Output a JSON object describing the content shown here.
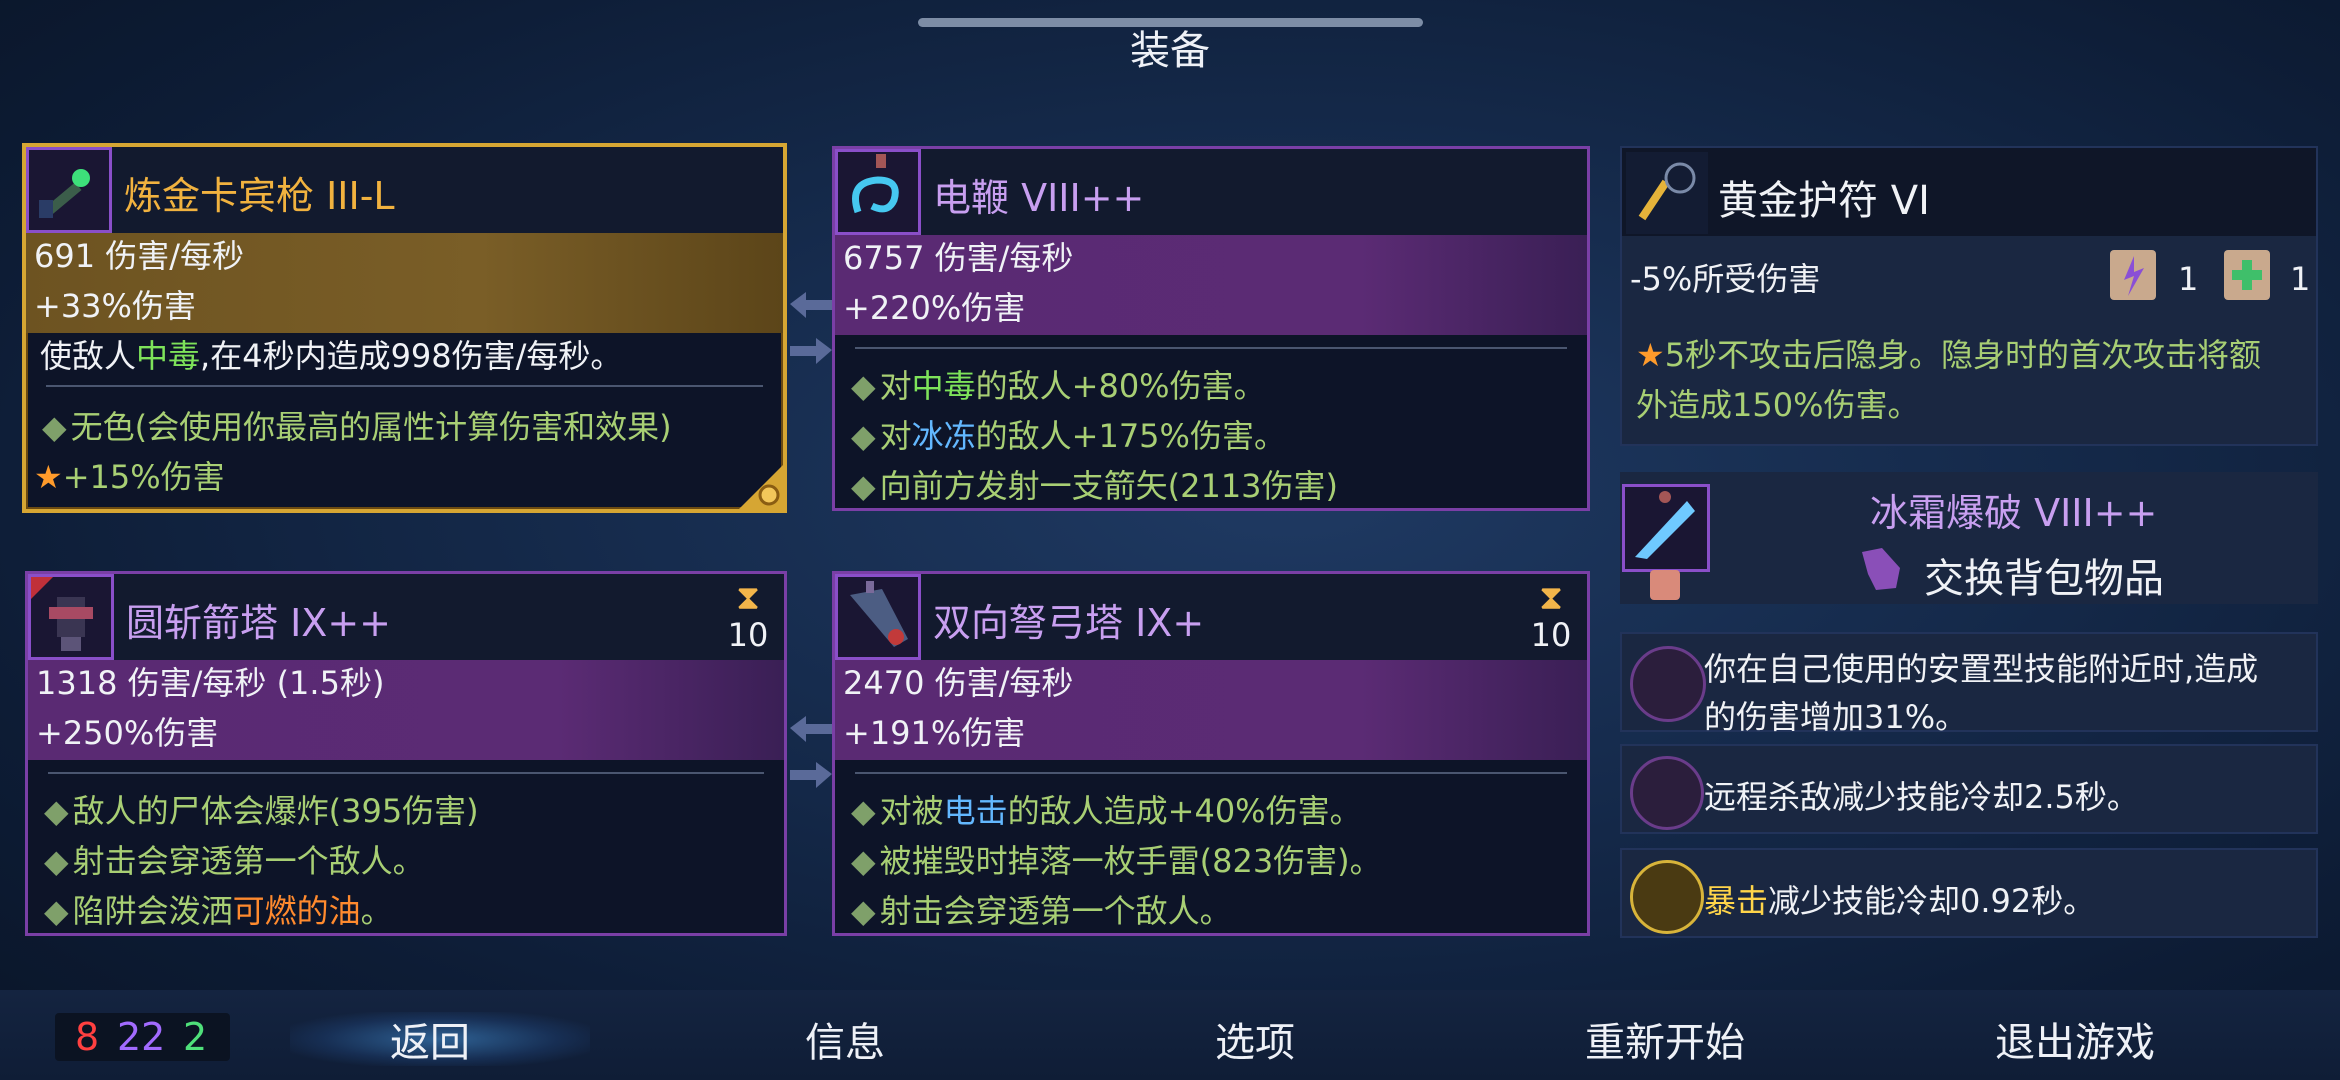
{
  "header": {
    "title": "装备"
  },
  "weapons": [
    {
      "name": "炼金卡宾枪 III-L",
      "stat1": "691 伤害/每秒",
      "stat2": "+33%伤害",
      "desc_pre": "使敌人",
      "desc_hl": "中毒",
      "desc_post": ",在4秒内造成998伤害/每秒。",
      "line1": "无色(会使用你最高的属性计算伤害和效果)",
      "line2": "+15%伤害"
    },
    {
      "name": "电鞭 VIII++",
      "stat1": "6757 伤害/每秒",
      "stat2": "+220%伤害",
      "l1_pre": "对",
      "l1_hl": "中毒",
      "l1_post": "的敌人+80%伤害。",
      "l2_pre": "对",
      "l2_hl": "冰冻",
      "l2_post": "的敌人+175%伤害。",
      "l3": "向前方发射一支箭矢(2113伤害)"
    }
  ],
  "skills": [
    {
      "name": "圆斩箭塔 IX++",
      "cooldown": "10",
      "stat1": "1318 伤害/每秒 (1.5秒)",
      "stat2": "+250%伤害",
      "l1": "敌人的尸体会爆炸(395伤害)",
      "l2": "射击会穿透第一个敌人。",
      "l3_pre": "陷阱会泼洒",
      "l3_hl": "可燃的油",
      "l3_post": "。"
    },
    {
      "name": "双向弩弓塔 IX+",
      "cooldown": "10",
      "stat1": "2470 伤害/每秒",
      "stat2": "+191%伤害",
      "l1_pre": "对被",
      "l1_hl": "电击",
      "l1_post": "的敌人造成+40%伤害。",
      "l2": "被摧毁时掉落一枚手雷(823伤害)。",
      "l3": "射击会穿透第一个敌人。"
    }
  ],
  "amulet": {
    "name": "黄金护符 VI",
    "stat": "-5%所受伤害",
    "scroll1_count": "1",
    "scroll2_count": "1",
    "desc_l1": "5秒不攻击后隐身。隐身时的首次攻击将额",
    "desc_l2": "外造成150%伤害。"
  },
  "backpack": {
    "name": "冰霜爆破 VIII++",
    "action": "交换背包物品"
  },
  "mutations": [
    {
      "l1": "你在自己使用的安置型技能附近时,造成",
      "l2": "的伤害增加31%。"
    },
    {
      "text": "远程杀敌减少技能冷却2.5秒。"
    },
    {
      "hl": "暴击",
      "text": "减少技能冷却0.92秒。"
    }
  ],
  "scroll_counter": {
    "brutality": "8",
    "tactics": "22",
    "survival": "2"
  },
  "bottom_nav": {
    "back": "返回",
    "info": "信息",
    "options": "选项",
    "restart": "重新开始",
    "quit": "退出游戏"
  },
  "colors": {
    "brutality": "#ff4040",
    "tactics": "#a26bff",
    "survival": "#4fe07a",
    "legendary_gold": "#d6a633",
    "purple_border": "#7a3fa6"
  }
}
